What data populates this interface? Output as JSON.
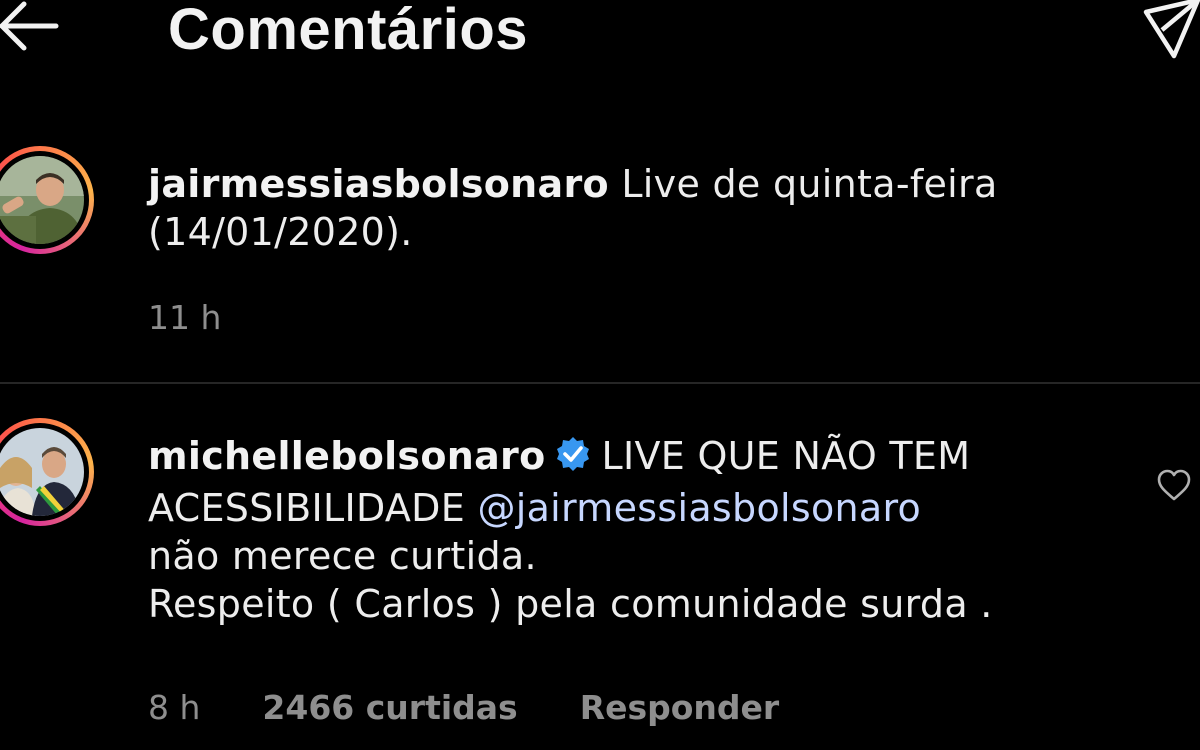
{
  "header": {
    "title": "Comentários"
  },
  "icons": {
    "back": "arrow-left-icon",
    "share": "paper-plane-icon",
    "verified": "verified-badge-icon",
    "like": "heart-outline-icon"
  },
  "colors": {
    "background": "#000000",
    "text": "#ededed",
    "meta": "#8e8e8e",
    "mention": "#c7d7ff",
    "verified": "#3897f0",
    "story_ring_start": "#d6249f",
    "story_ring_end": "#fdb44b"
  },
  "caption": {
    "username": "jairmessiasbolsonaro",
    "text_line1": "Live de quinta-feira",
    "text_line2": "(14/01/2020).",
    "time": "11 h"
  },
  "comment": {
    "username": "michellebolsonaro",
    "text_line1": "LIVE QUE NÃO TEM",
    "text_line2_prefix": "ACESSIBILIDADE",
    "mention": "@jairmessiasbolsonaro",
    "text_line3": "não merece curtida.",
    "text_line4": "Respeito ( Carlos ) pela comunidade surda .",
    "time": "8 h",
    "likes": "2466 curtidas",
    "reply_label": "Responder"
  }
}
